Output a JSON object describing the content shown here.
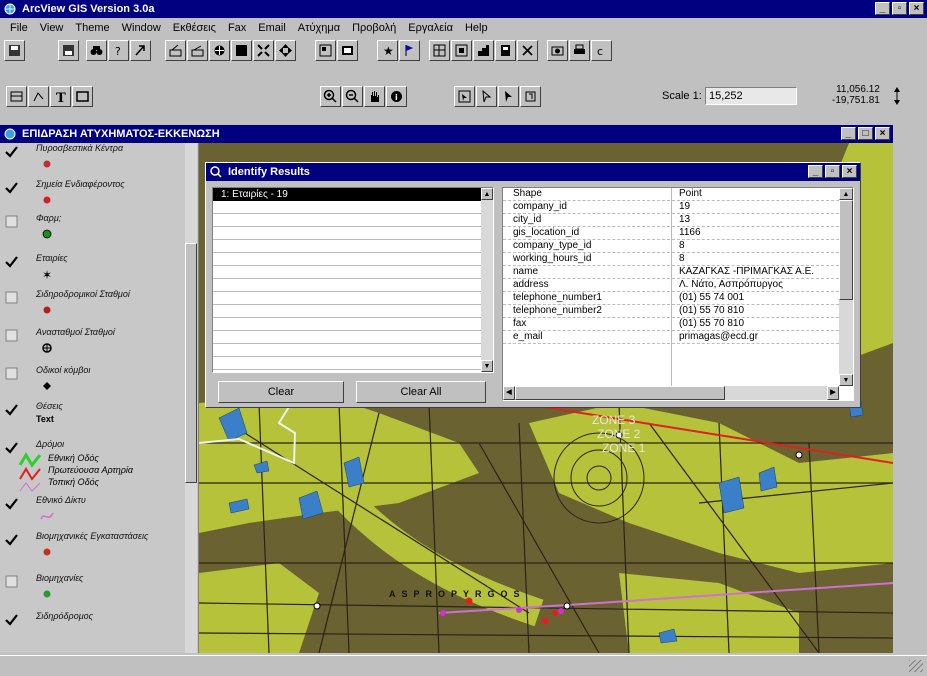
{
  "app": {
    "title": "ArcView GIS Version 3.0a",
    "window_buttons": [
      "_",
      "▫",
      "×"
    ]
  },
  "menu": [
    "File",
    "View",
    "Theme",
    "Window",
    "Εκθέσεις",
    "Fax",
    "Email",
    "Ατύχημα",
    "Προβολή",
    "Εργαλεία",
    "Help"
  ],
  "scale": {
    "label": "Scale 1:",
    "value": "15,252",
    "coord_x": "11,056.12",
    "coord_y": "-19,751.81"
  },
  "view_window": {
    "title": "ΕΠΙΔΡΑΣΗ ΑΤΥΧΗΜΑΤΟΣ-ΕΚΚΕΝΩΣΗ",
    "buttons": [
      "_",
      "□",
      "×"
    ]
  },
  "legend": [
    {
      "label": "Πυροσβεστικά Κέντρα",
      "checked": true,
      "symbol": "dot",
      "color": "#c03030"
    },
    {
      "label": "Σημεία Ενδιαφέροντος",
      "checked": true,
      "symbol": "dot",
      "color": "#d02020"
    },
    {
      "label": "Φαρμ;",
      "checked": false,
      "symbol": "dot-ring",
      "color": "#1a8f1a"
    },
    {
      "label": "Εταιρίες",
      "checked": true,
      "symbol": "star",
      "color": "#000000"
    },
    {
      "label": "Σιδηροδρομικοί Σταθμοί",
      "checked": false,
      "symbol": "dot",
      "color": "#b02020"
    },
    {
      "label": "Ανασταθμοί Σταθμοί",
      "checked": false,
      "symbol": "cross-dot",
      "color": "#000000"
    },
    {
      "label": "Οδικοί κόμβοι",
      "checked": false,
      "symbol": "diamond",
      "color": "#000000"
    },
    {
      "label": "Θέσεις",
      "checked": true,
      "symbol": "text",
      "color": "#000000",
      "symbol_text": "Text"
    },
    {
      "label": "Δρόμοι",
      "checked": true,
      "symbol": "roads",
      "color": "#000000",
      "sub": [
        "Εθνική Οδός",
        "Πρωτεύουσα Αρτηρία",
        "Τοπική Οδός"
      ]
    },
    {
      "label": "Εθνικό Δίκτυ",
      "checked": true,
      "symbol": "line",
      "color": "#d070d0"
    },
    {
      "label": "Βιομηχανικές Εγκαταστάσεις",
      "checked": true,
      "symbol": "dot",
      "color": "#c03020"
    },
    {
      "label": "Βιομηχανίες",
      "checked": false,
      "symbol": "dot",
      "color": "#2a9a2a"
    },
    {
      "label": "Σιδηρόδρομος",
      "checked": true,
      "symbol": "none",
      "color": "#000000"
    }
  ],
  "identify": {
    "title": "Identify Results",
    "list_items": [
      "1: Εταιρίες - 19"
    ],
    "clear_label": "Clear",
    "clear_all_label": "Clear All",
    "headers": [
      "Shape",
      "Point"
    ],
    "rows": [
      {
        "k": "company_id",
        "v": "19"
      },
      {
        "k": "city_id",
        "v": "13"
      },
      {
        "k": "gis_location_id",
        "v": "1166"
      },
      {
        "k": "company_type_id",
        "v": "8"
      },
      {
        "k": "working_hours_id",
        "v": "8"
      },
      {
        "k": "name",
        "v": "ΚΑΖΑΓΚΑΣ -ΠΡΙΜΑΓΚΑΣ Α.Ε."
      },
      {
        "k": "address",
        "v": "Λ. Νάτο, Ασπρόπυργος"
      },
      {
        "k": "telephone_number1",
        "v": "(01) 55 74 001"
      },
      {
        "k": "telephone_number2",
        "v": "(01) 55 70 810"
      },
      {
        "k": "fax",
        "v": "(01) 55 70 810"
      },
      {
        "k": "e_mail",
        "v": "primagas@ecd.gr"
      }
    ]
  },
  "map_labels": {
    "town": "ASPROPYRGOS",
    "zones": [
      "ZONE 3",
      "ZONE 2",
      "ZONE 1"
    ]
  },
  "colors": {
    "title_bar": "#000080",
    "map_background": "#6b6232",
    "map_green": "#b5c23a",
    "map_blue": "#3a7fc8"
  }
}
